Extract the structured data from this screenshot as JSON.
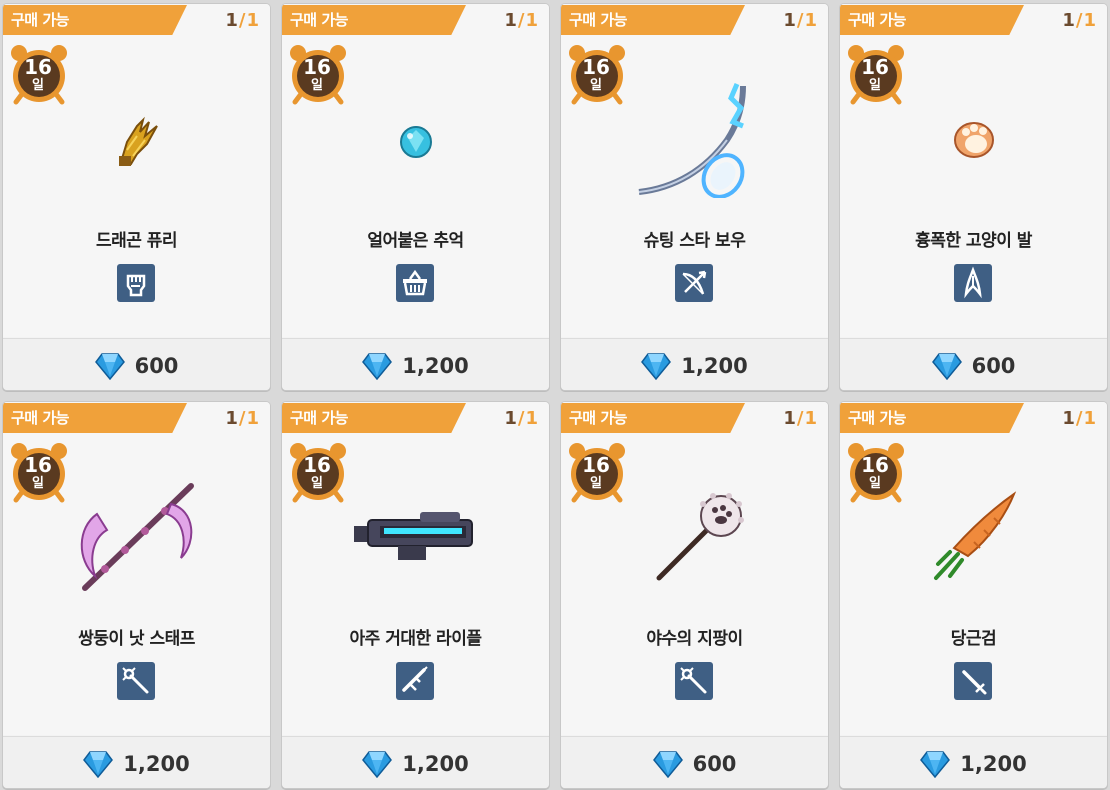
{
  "colors": {
    "banner": "#f0a13a",
    "stock_current": "#6b4a2e",
    "timer_badge": "#e8962f",
    "type_icon_bg": "#3f5f84",
    "gem": "#2a9be0"
  },
  "shop": {
    "items": [
      {
        "status": "구매 가능",
        "stock_current": "1",
        "stock_sep": "/",
        "stock_total": "1",
        "days": "16",
        "days_unit": "일",
        "name": "드래곤 퓨리",
        "type_icon": "fist-icon",
        "art": "golden-claw-art",
        "price": "600"
      },
      {
        "status": "구매 가능",
        "stock_current": "1",
        "stock_sep": "/",
        "stock_total": "1",
        "days": "16",
        "days_unit": "일",
        "name": "얼어붙은 추억",
        "type_icon": "basket-icon",
        "art": "ice-gem-art",
        "price": "1,200"
      },
      {
        "status": "구매 가능",
        "stock_current": "1",
        "stock_sep": "/",
        "stock_total": "1",
        "days": "16",
        "days_unit": "일",
        "name": "슈팅 스타 보우",
        "type_icon": "bow-icon",
        "art": "star-bow-art",
        "price": "1,200"
      },
      {
        "status": "구매 가능",
        "stock_current": "1",
        "stock_sep": "/",
        "stock_total": "1",
        "days": "16",
        "days_unit": "일",
        "name": "흉폭한 고양이 발",
        "type_icon": "claw-icon",
        "art": "cat-paw-art",
        "price": "600"
      },
      {
        "status": "구매 가능",
        "stock_current": "1",
        "stock_sep": "/",
        "stock_total": "1",
        "days": "16",
        "days_unit": "일",
        "name": "쌍둥이 낫 스태프",
        "type_icon": "staff-icon",
        "art": "twin-scythe-art",
        "price": "1,200"
      },
      {
        "status": "구매 가능",
        "stock_current": "1",
        "stock_sep": "/",
        "stock_total": "1",
        "days": "16",
        "days_unit": "일",
        "name": "아주 거대한 라이플",
        "type_icon": "rifle-icon",
        "art": "giant-rifle-art",
        "price": "1,200"
      },
      {
        "status": "구매 가능",
        "stock_current": "1",
        "stock_sep": "/",
        "stock_total": "1",
        "days": "16",
        "days_unit": "일",
        "name": "야수의 지팡이",
        "type_icon": "staff-icon",
        "art": "beast-staff-art",
        "price": "600"
      },
      {
        "status": "구매 가능",
        "stock_current": "1",
        "stock_sep": "/",
        "stock_total": "1",
        "days": "16",
        "days_unit": "일",
        "name": "당근검",
        "type_icon": "sword-icon",
        "art": "carrot-sword-art",
        "price": "1,200"
      }
    ]
  }
}
